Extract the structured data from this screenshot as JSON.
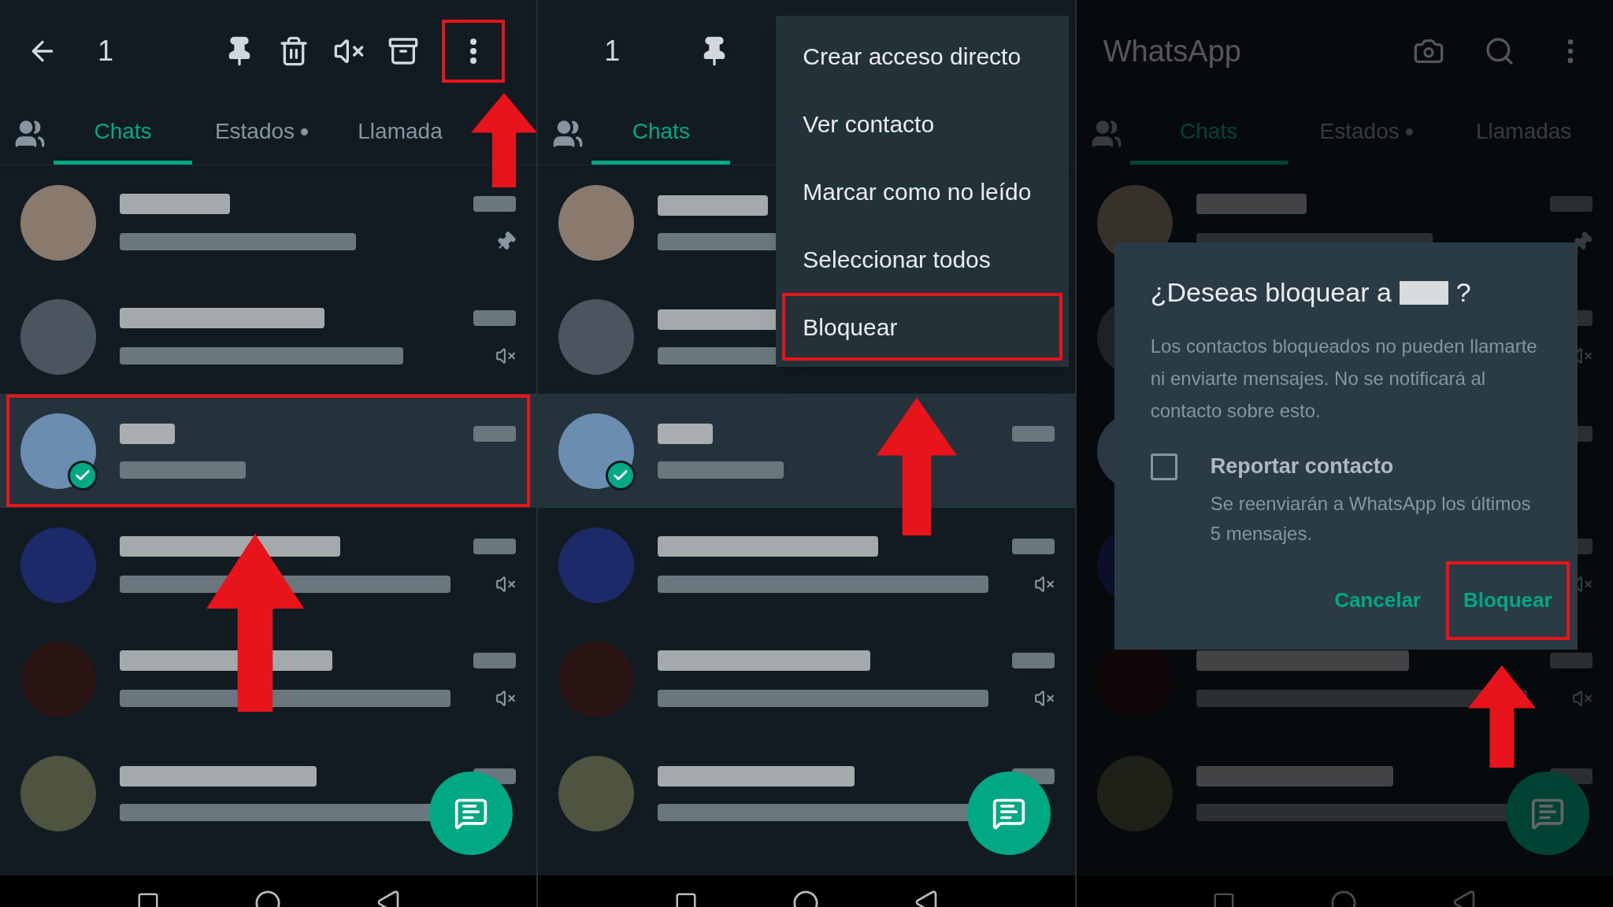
{
  "panels": [
    {
      "kind": "selection",
      "count": "1",
      "more_framed": true,
      "tabs": [
        {
          "label": "Chats",
          "selected": true,
          "dot": false
        },
        {
          "label": "Estados",
          "selected": false,
          "dot": true
        },
        {
          "label": "Llamada",
          "selected": false,
          "dot": false
        }
      ],
      "chats": [
        {
          "selected": false,
          "pinned": true,
          "muted": false,
          "badge": false,
          "framed": false
        },
        {
          "selected": false,
          "pinned": false,
          "muted": true,
          "badge": false,
          "framed": false
        },
        {
          "selected": true,
          "pinned": false,
          "muted": false,
          "badge": true,
          "framed": true
        },
        {
          "selected": false,
          "pinned": false,
          "muted": true,
          "badge": false,
          "framed": false
        },
        {
          "selected": false,
          "pinned": false,
          "muted": true,
          "badge": false,
          "framed": false
        },
        {
          "selected": false,
          "pinned": false,
          "muted": false,
          "badge": false,
          "framed": false
        }
      ]
    },
    {
      "kind": "menu",
      "count": "1",
      "tabs": [
        {
          "label": "Chats",
          "selected": true,
          "dot": false
        }
      ],
      "chats": [
        {
          "selected": false,
          "pinned": false,
          "muted": false,
          "badge": false,
          "framed": false
        },
        {
          "selected": false,
          "pinned": false,
          "muted": false,
          "badge": false,
          "framed": false
        },
        {
          "selected": true,
          "pinned": false,
          "muted": false,
          "badge": true,
          "framed": false
        },
        {
          "selected": false,
          "pinned": false,
          "muted": true,
          "badge": false,
          "framed": false
        },
        {
          "selected": false,
          "pinned": false,
          "muted": true,
          "badge": false,
          "framed": false
        },
        {
          "selected": false,
          "pinned": false,
          "muted": false,
          "badge": false,
          "framed": false
        }
      ],
      "menu": [
        {
          "label": "Crear acceso directo",
          "framed": false
        },
        {
          "label": "Ver contacto",
          "framed": false
        },
        {
          "label": "Marcar como no leído",
          "framed": false
        },
        {
          "label": "Seleccionar todos",
          "framed": false
        },
        {
          "label": "Bloquear",
          "framed": true
        }
      ]
    },
    {
      "kind": "dialog",
      "title": "WhatsApp",
      "dimmed": true,
      "tabs": [
        {
          "label": "Chats",
          "selected": true,
          "dot": false
        },
        {
          "label": "Estados",
          "selected": false,
          "dot": true
        },
        {
          "label": "Llamadas",
          "selected": false,
          "dot": false
        }
      ],
      "chats": [
        {
          "pinned": true,
          "muted": false
        },
        {
          "pinned": false,
          "muted": true
        },
        {
          "pinned": false,
          "muted": false
        },
        {
          "pinned": false,
          "muted": true
        },
        {
          "pinned": false,
          "muted": true
        },
        {
          "pinned": false,
          "muted": false
        }
      ],
      "dialog": {
        "title_before": "¿Deseas bloquear a",
        "title_after": "?",
        "body": "Los contactos bloqueados no pueden llamarte ni enviarte mensajes. No se notificará al contacto sobre esto.",
        "checkbox": {
          "label": "Reportar contacto",
          "hint": "Se reenviarán a WhatsApp los últimos 5 mensajes.",
          "checked": false
        },
        "buttons": [
          {
            "label": "Cancelar",
            "framed": false
          },
          {
            "label": "Bloquear",
            "framed": true
          }
        ]
      }
    }
  ]
}
